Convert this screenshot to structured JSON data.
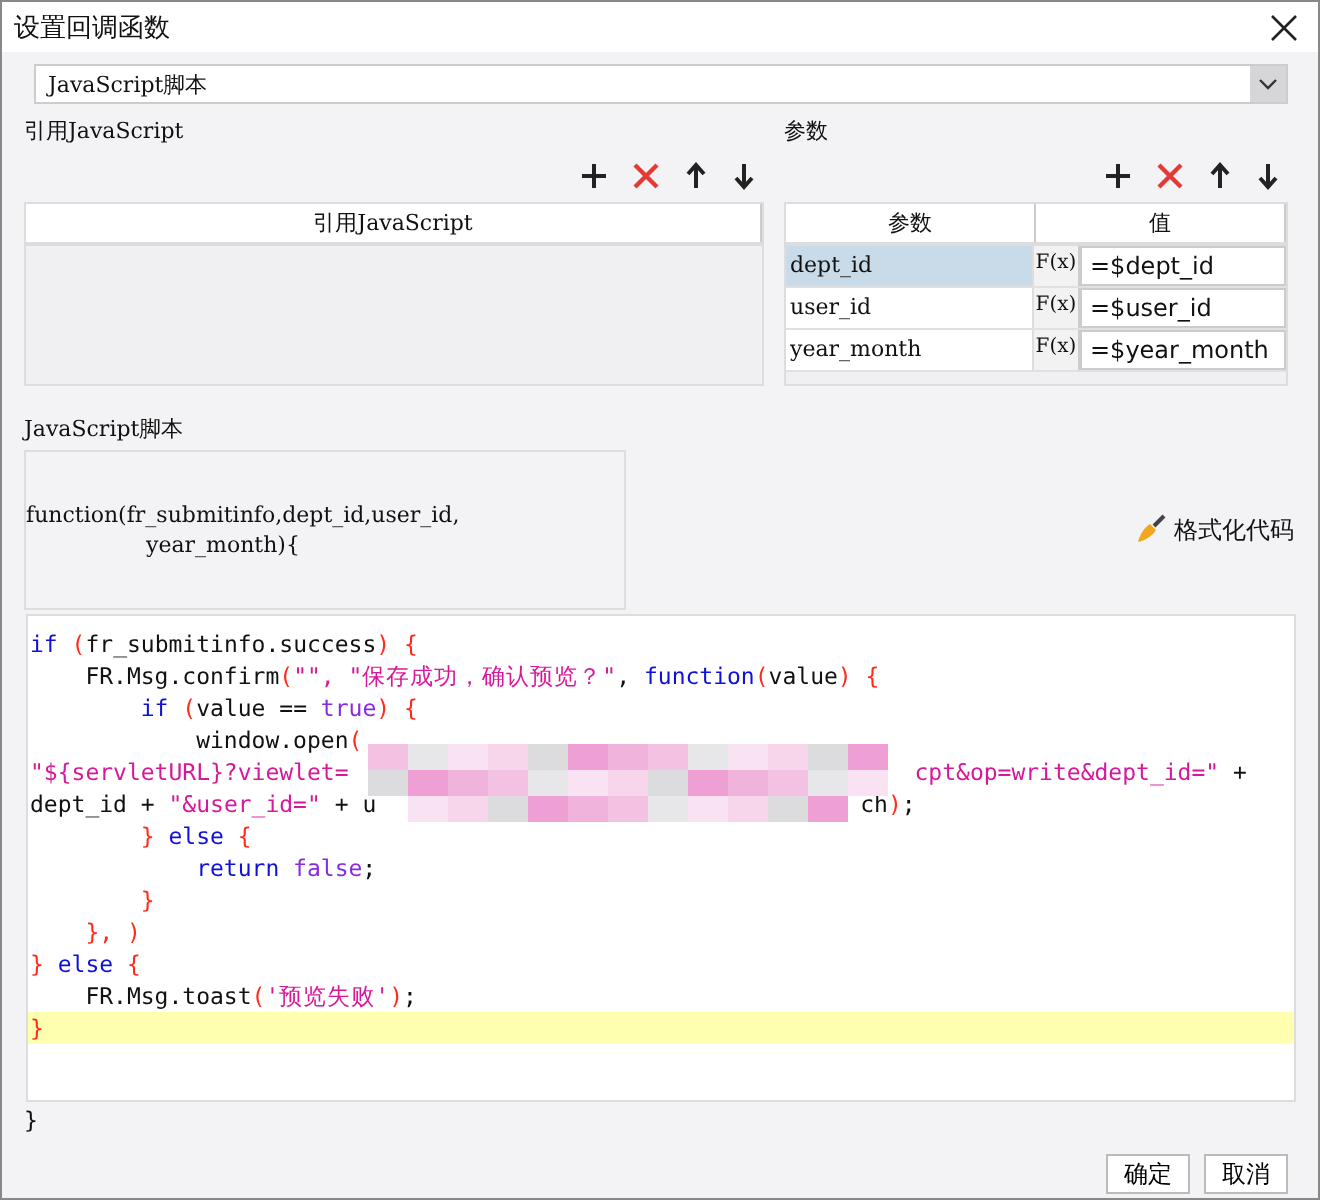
{
  "window": {
    "title": "设置回调函数"
  },
  "script_type": {
    "value": "JavaScript脚本"
  },
  "references": {
    "legend": "引用JavaScript",
    "columns": [
      "引用JavaScript"
    ]
  },
  "parameters": {
    "legend": "参数",
    "columns": [
      "参数",
      "值"
    ],
    "rows": [
      {
        "name": "dept_id",
        "fx": "F(x)",
        "value": "=$dept_id",
        "selected": true
      },
      {
        "name": "user_id",
        "fx": "F(x)",
        "value": "=$user_id",
        "selected": false
      },
      {
        "name": "year_month",
        "fx": "F(x)",
        "value": "=$year_month",
        "selected": false
      }
    ]
  },
  "script": {
    "legend": "JavaScript脚本",
    "signature": [
      "function(fr_submitinfo,dept_id,user_id,",
      "year_month){"
    ],
    "format_button": "格式化代码",
    "lines": [
      {
        "current": false,
        "tokens": [
          {
            "kind": "kw",
            "text": "if"
          },
          {
            "kind": "punc",
            "text": " ("
          },
          {
            "kind": "plain",
            "text": "fr_submitinfo.success"
          },
          {
            "kind": "punc",
            "text": ") {"
          }
        ]
      },
      {
        "current": false,
        "tokens": [
          {
            "kind": "plain",
            "text": "    FR.Msg.confirm"
          },
          {
            "kind": "punc",
            "text": "("
          },
          {
            "kind": "str",
            "text": "\"\", \"保存成功，确认预览？\""
          },
          {
            "kind": "plain",
            "text": ", "
          },
          {
            "kind": "kw",
            "text": "function"
          },
          {
            "kind": "punc",
            "text": "("
          },
          {
            "kind": "plain",
            "text": "value"
          },
          {
            "kind": "punc",
            "text": ") {"
          }
        ]
      },
      {
        "current": false,
        "tokens": [
          {
            "kind": "kw",
            "text": "        if"
          },
          {
            "kind": "punc",
            "text": " ("
          },
          {
            "kind": "plain",
            "text": "value == "
          },
          {
            "kind": "lit",
            "text": "true"
          },
          {
            "kind": "punc",
            "text": ") {"
          }
        ]
      },
      {
        "current": false,
        "tokens": [
          {
            "kind": "plain",
            "text": "            window.open"
          },
          {
            "kind": "punc",
            "text": "("
          }
        ]
      },
      {
        "current": false,
        "tokens": [
          {
            "kind": "str",
            "text": "\"${servletURL}?viewlet="
          }
        ],
        "tail": [
          {
            "kind": "str",
            "text": "cpt&op=write&dept_id=\""
          },
          {
            "kind": "plain",
            "text": " +"
          }
        ]
      },
      {
        "current": false,
        "tokens": [
          {
            "kind": "plain",
            "text": "dept_id + "
          },
          {
            "kind": "str",
            "text": "\"&user_id=\""
          },
          {
            "kind": "plain",
            "text": " + u"
          }
        ],
        "tail": [
          {
            "kind": "plain",
            "text": "ch"
          },
          {
            "kind": "punc",
            "text": ")"
          },
          {
            "kind": "plain",
            "text": ";"
          }
        ]
      },
      {
        "current": false,
        "tokens": [
          {
            "kind": "punc",
            "text": "        }"
          },
          {
            "kind": "kw",
            "text": " else"
          },
          {
            "kind": "punc",
            "text": " {"
          }
        ]
      },
      {
        "current": false,
        "tokens": [
          {
            "kind": "kw",
            "text": "            return"
          },
          {
            "kind": "lit",
            "text": " false"
          },
          {
            "kind": "plain",
            "text": ";"
          }
        ]
      },
      {
        "current": false,
        "tokens": [
          {
            "kind": "punc",
            "text": "        }"
          }
        ]
      },
      {
        "current": false,
        "tokens": [
          {
            "kind": "punc",
            "text": "    }, )"
          }
        ]
      },
      {
        "current": false,
        "tokens": [
          {
            "kind": "punc",
            "text": "}"
          },
          {
            "kind": "kw",
            "text": " else"
          },
          {
            "kind": "punc",
            "text": " {"
          }
        ]
      },
      {
        "current": false,
        "tokens": [
          {
            "kind": "plain",
            "text": "    FR.Msg.toast"
          },
          {
            "kind": "punc",
            "text": "("
          },
          {
            "kind": "str",
            "text": "'预览失败'"
          },
          {
            "kind": "punc",
            "text": ")"
          },
          {
            "kind": "plain",
            "text": ";"
          }
        ]
      },
      {
        "current": true,
        "tokens": [
          {
            "kind": "punc",
            "text": "}"
          }
        ]
      }
    ],
    "closing": "}"
  },
  "buttons": [
    "确定",
    "取消"
  ]
}
